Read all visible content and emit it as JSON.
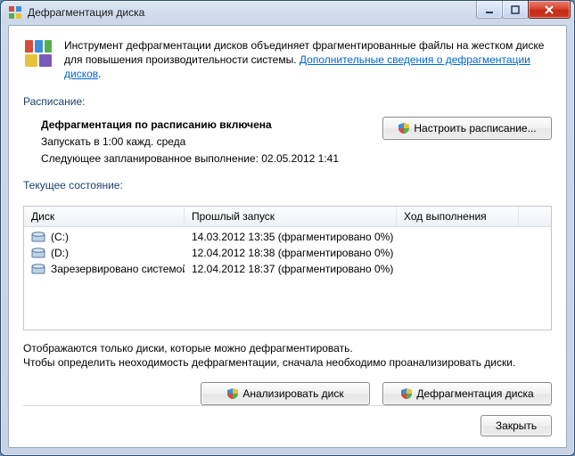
{
  "window": {
    "title": "Дефрагментация диска"
  },
  "intro": {
    "text_before_link": "Инструмент дефрагментации дисков объединяет фрагментированные файлы на жестком диске для повышения производительности системы. ",
    "link": "Дополнительные сведения о дефрагментации дисков"
  },
  "schedule": {
    "label": "Расписание:",
    "title": "Дефрагментация по расписанию включена",
    "run_at": "Запускать в 1:00 кажд. среда",
    "next_run": "Следующее запланированное выполнение: 02.05.2012 1:41",
    "configure_btn": "Настроить расписание..."
  },
  "current_state_label": "Текущее состояние:",
  "table": {
    "headers": {
      "disk": "Диск",
      "last_run": "Прошлый запуск",
      "progress": "Ход выполнения"
    },
    "rows": [
      {
        "name": "(C:)",
        "last": "14.03.2012 13:35 (фрагментировано 0%)",
        "progress": ""
      },
      {
        "name": "(D:)",
        "last": "12.04.2012 18:38 (фрагментировано 0%)",
        "progress": ""
      },
      {
        "name": "Зарезервировано системой",
        "last": "12.04.2012 18:37 (фрагментировано 0%)",
        "progress": ""
      }
    ]
  },
  "note": {
    "line1": "Отображаются только диски, которые можно дефрагментировать.",
    "line2": "Чтобы определить неоходимость дефрагментации, сначала необходимо проанализировать диски."
  },
  "buttons": {
    "analyze": "Анализировать диск",
    "defrag": "Дефрагментация диска",
    "close": "Закрыть"
  },
  "icons": {
    "app": "defrag-app",
    "shield": "uac-shield",
    "disk": "hard-disk"
  }
}
